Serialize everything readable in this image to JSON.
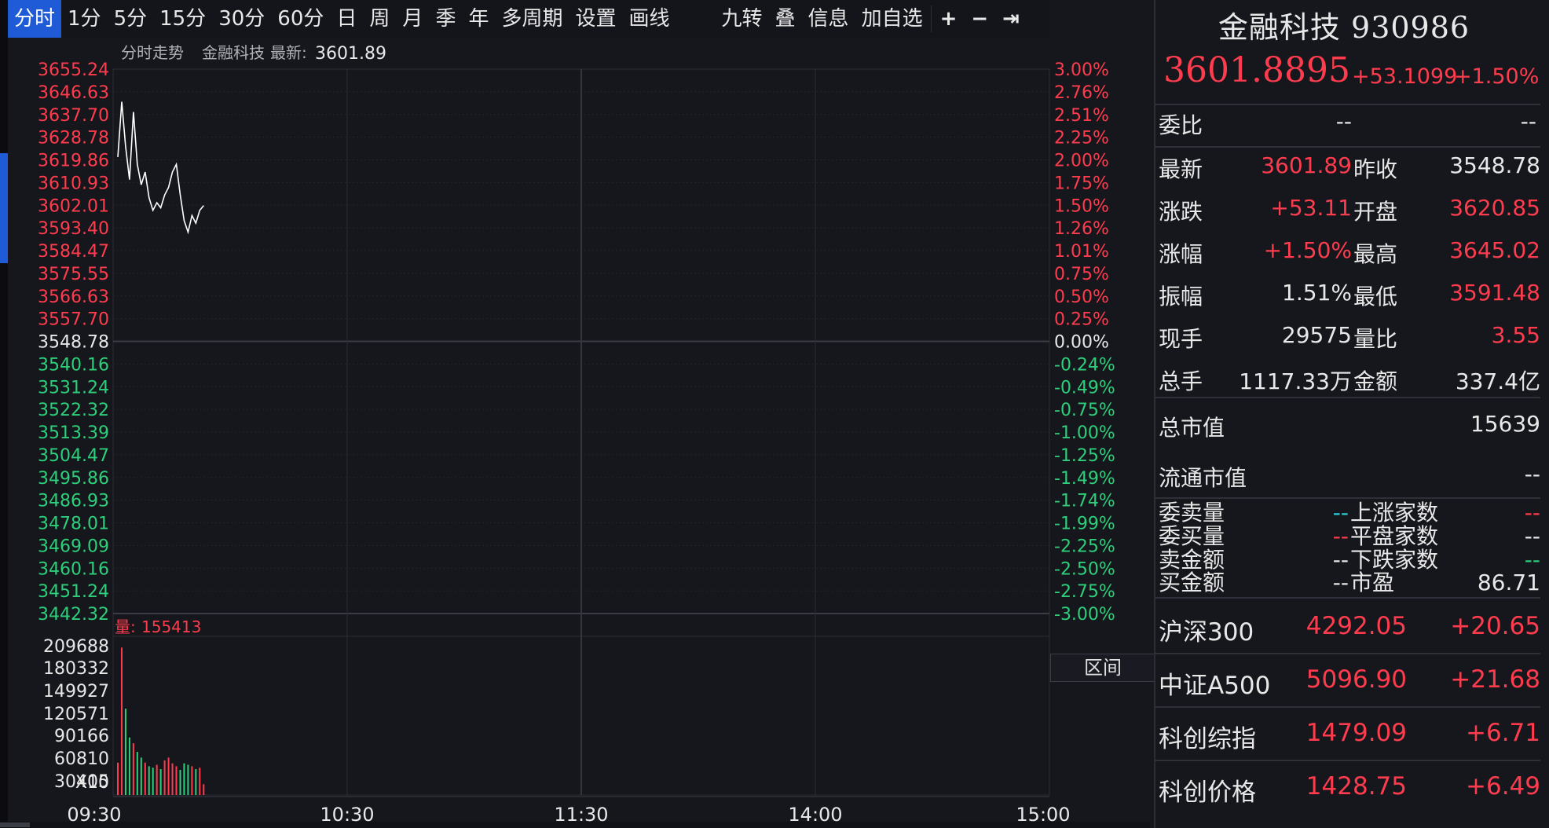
{
  "toolbar": {
    "periods": [
      "分时",
      "1分",
      "5分",
      "15分",
      "30分",
      "60分",
      "日",
      "周",
      "月",
      "季",
      "年",
      "多周期",
      "设置",
      "画线"
    ],
    "active": "分时",
    "tools": [
      "九转",
      "叠",
      "信息",
      "加自选"
    ],
    "icons": [
      "plus-icon",
      "minus-icon",
      "arrow-to-end-icon"
    ]
  },
  "chart": {
    "title": "分时走势",
    "stock_name": "金融科技",
    "latest_label": "最新:",
    "latest_value": "3601.89",
    "volume_label": "量:",
    "volume_value": "155413",
    "volume_multiplier": "X10",
    "range_button": "区间",
    "colors": {
      "up": "#ff3c4d",
      "down": "#2ecf7a",
      "neutral": "#e8e8e8",
      "line": "#ffffff",
      "grid": "#2a2c34",
      "volume_bar": "#ff3c4d"
    }
  },
  "chart_data": {
    "type": "line",
    "x_ticks": [
      "09:30",
      "10:30",
      "11:30",
      "14:00",
      "15:00"
    ],
    "price_ticks": [
      "3655.24",
      "3646.63",
      "3637.70",
      "3628.78",
      "3619.86",
      "3610.93",
      "3602.01",
      "3593.40",
      "3584.47",
      "3575.55",
      "3566.63",
      "3557.70",
      "3548.78",
      "3540.16",
      "3531.24",
      "3522.32",
      "3513.39",
      "3504.47",
      "3495.86",
      "3486.93",
      "3478.01",
      "3469.09",
      "3460.16",
      "3451.24",
      "3442.32"
    ],
    "pct_ticks": [
      "3.00%",
      "2.76%",
      "2.51%",
      "2.25%",
      "2.00%",
      "1.75%",
      "1.50%",
      "1.26%",
      "1.01%",
      "0.75%",
      "0.50%",
      "0.25%",
      "0.00%",
      "-0.24%",
      "-0.49%",
      "-0.75%",
      "-1.00%",
      "-1.25%",
      "-1.49%",
      "-1.74%",
      "-1.99%",
      "-2.25%",
      "-2.50%",
      "-2.75%",
      "-3.00%"
    ],
    "y_range": [
      3442.32,
      3655.24
    ],
    "base_price": 3548.78,
    "price_series": {
      "minutes": [
        0,
        1,
        2,
        3,
        4,
        5,
        6,
        7,
        8,
        9,
        10,
        11,
        12,
        13,
        14,
        15,
        16,
        17,
        18,
        19,
        20,
        21,
        22
      ],
      "values": [
        3620.85,
        3642.5,
        3625.0,
        3612.0,
        3638.5,
        3618.0,
        3610.0,
        3615.0,
        3605.0,
        3600.0,
        3603.0,
        3601.0,
        3606.0,
        3609.0,
        3615.0,
        3618.0,
        3606.0,
        3596.0,
        3591.48,
        3598.0,
        3595.0,
        3600.0,
        3601.89
      ]
    },
    "volume_ticks": [
      "209688",
      "180332",
      "149927",
      "120571",
      "90166",
      "60810",
      "30405"
    ],
    "volume_range": [
      0,
      209688
    ],
    "volume_series": {
      "minutes": [
        0,
        1,
        2,
        3,
        4,
        5,
        6,
        7,
        8,
        9,
        10,
        11,
        12,
        13,
        14,
        15,
        16,
        17,
        18,
        19,
        20,
        21,
        22
      ],
      "values": [
        45000,
        205000,
        120000,
        80000,
        72000,
        60000,
        52000,
        45000,
        40000,
        38000,
        42000,
        36000,
        48000,
        52000,
        44000,
        40000,
        35000,
        44000,
        42000,
        40000,
        36000,
        38000,
        15000
      ]
    }
  },
  "panel": {
    "name": "金融科技",
    "code": "930986",
    "price": "3601.8895",
    "change": "+53.1099",
    "pct": "+1.50%",
    "weibi_label": "委比",
    "weibi_val1": "--",
    "weibi_val2": "--",
    "rows": [
      {
        "l1": "最新",
        "v1": "3601.89",
        "c1": "red",
        "l2": "昨收",
        "v2": "3548.78",
        "c2": "white"
      },
      {
        "l1": "涨跌",
        "v1": "+53.11",
        "c1": "red",
        "l2": "开盘",
        "v2": "3620.85",
        "c2": "red"
      },
      {
        "l1": "涨幅",
        "v1": "+1.50%",
        "c1": "red",
        "l2": "最高",
        "v2": "3645.02",
        "c2": "red"
      },
      {
        "l1": "振幅",
        "v1": "1.51%",
        "c1": "white",
        "l2": "最低",
        "v2": "3591.48",
        "c2": "red"
      },
      {
        "l1": "现手",
        "v1": "29575",
        "c1": "white",
        "l2": "量比",
        "v2": "3.55",
        "c2": "red"
      },
      {
        "l1": "总手",
        "v1": "1117.33万",
        "c1": "white",
        "l2": "金额",
        "v2": "337.4亿",
        "c2": "white"
      }
    ],
    "market_cap_label": "总市值",
    "market_cap_val": "15639",
    "float_cap_label": "流通市值",
    "float_cap_val": "--",
    "small_rows": [
      {
        "l1": "委卖量",
        "v1": "--",
        "c1": "cyan",
        "l2": "上涨家数",
        "v2": "--",
        "c2": "red"
      },
      {
        "l1": "委买量",
        "v1": "--",
        "c1": "red",
        "l2": "平盘家数",
        "v2": "--",
        "c2": "white"
      },
      {
        "l1": "卖金额",
        "v1": "--",
        "c1": "white",
        "l2": "下跌家数",
        "v2": "--",
        "c2": "green"
      },
      {
        "l1": "买金额",
        "v1": "--",
        "c1": "white",
        "l2": "市盈",
        "v2": "86.71",
        "c2": "white"
      }
    ],
    "indices": [
      {
        "name": "沪深300",
        "value": "4292.05",
        "change": "+20.65"
      },
      {
        "name": "中证A500",
        "value": "5096.90",
        "change": "+21.68"
      },
      {
        "name": "科创综指",
        "value": "1479.09",
        "change": "+6.71"
      },
      {
        "name": "科创价格",
        "value": "1428.75",
        "change": "+6.49"
      }
    ]
  }
}
